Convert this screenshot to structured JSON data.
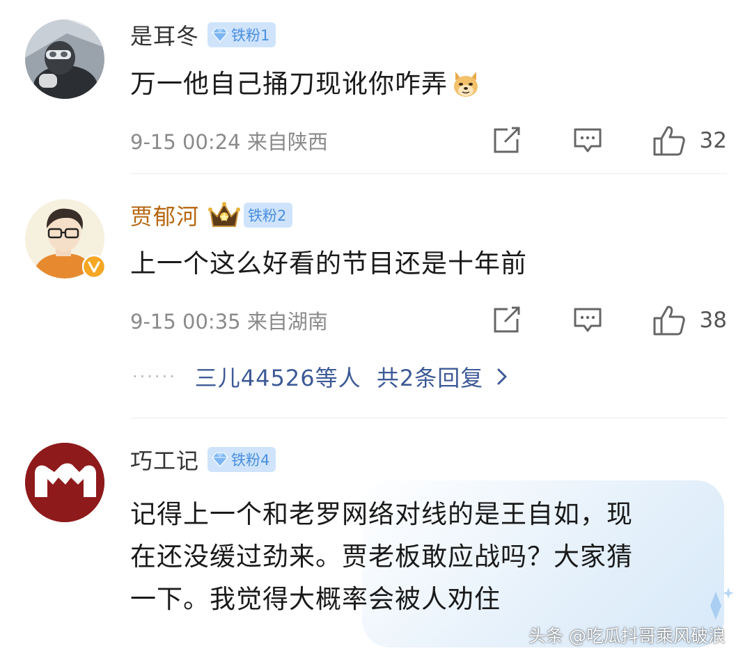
{
  "comments": [
    {
      "username": "是耳冬",
      "badge": "铁粉1",
      "text": "万一他自己捅刀现讹你咋弄",
      "emoji": "doge-emoji",
      "meta": "9-15 00:24 来自陕西",
      "likes": "32"
    },
    {
      "username": "贾郁河",
      "badge": "铁粉2",
      "text": "上一个这么好看的节目还是十年前",
      "meta": "9-15 00:35 来自湖南",
      "likes": "38",
      "replies": {
        "dots": "······",
        "text": "三儿44526等人  共2条回复"
      }
    },
    {
      "username": "巧工记",
      "badge": "铁粉4",
      "text_lines": [
        "记得上一个和老罗网络对线的是王自如，现",
        "在还没缓过劲来。贾老板敢应战吗？大家猜",
        "一下。我觉得大概率会被人劝住"
      ]
    }
  ],
  "watermark": "头条 @吃瓜抖哥乘风破浪",
  "colors": {
    "badge_bg": "#cfe4fb",
    "badge_text": "#4a8ee0",
    "gold_username": "#b5660f",
    "reply_link": "#3d5a96",
    "meta": "#8a8a8a"
  }
}
